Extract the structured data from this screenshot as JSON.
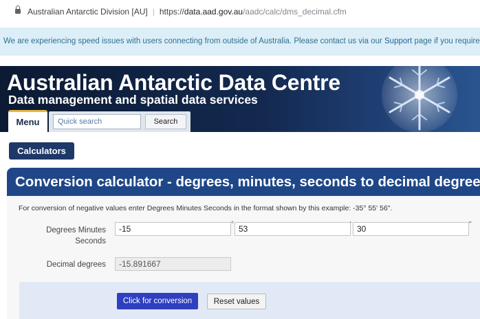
{
  "browser": {
    "site_name": "Australian Antarctic Division [AU]",
    "separator": "|",
    "url_protocol": "https://",
    "url_host": "data.aad.gov.au",
    "url_path": "/aadc/calc/dms_decimal.cfm"
  },
  "notice": {
    "text_before": "We are experiencing speed issues with users connecting from outside of Australia. Please contact us via our ",
    "link": "Support",
    "text_after": " page if you require assistance."
  },
  "header": {
    "title": "Australian Antarctic Data Centre",
    "subtitle": "Data management and spatial data services",
    "menu_label": "Menu",
    "search_placeholder": "Quick search",
    "search_button": "Search"
  },
  "calculators_label": "Calculators",
  "page_title": "Conversion calculator - degrees, minutes, seconds to decimal degrees",
  "instruction": "For conversion of negative values enter Degrees Minutes Seconds in the format shown by this example: -35° 55' 56\".",
  "form": {
    "dms_label": "Degrees Minutes Seconds",
    "degrees_value": "-15",
    "degrees_unit": "°",
    "minutes_value": "53",
    "minutes_unit": "'",
    "seconds_value": "30",
    "seconds_unit": "\"",
    "decimal_label": "Decimal degrees",
    "decimal_value": "-15.891667"
  },
  "buttons": {
    "convert": "Click for conversion",
    "reset": "Reset values"
  }
}
